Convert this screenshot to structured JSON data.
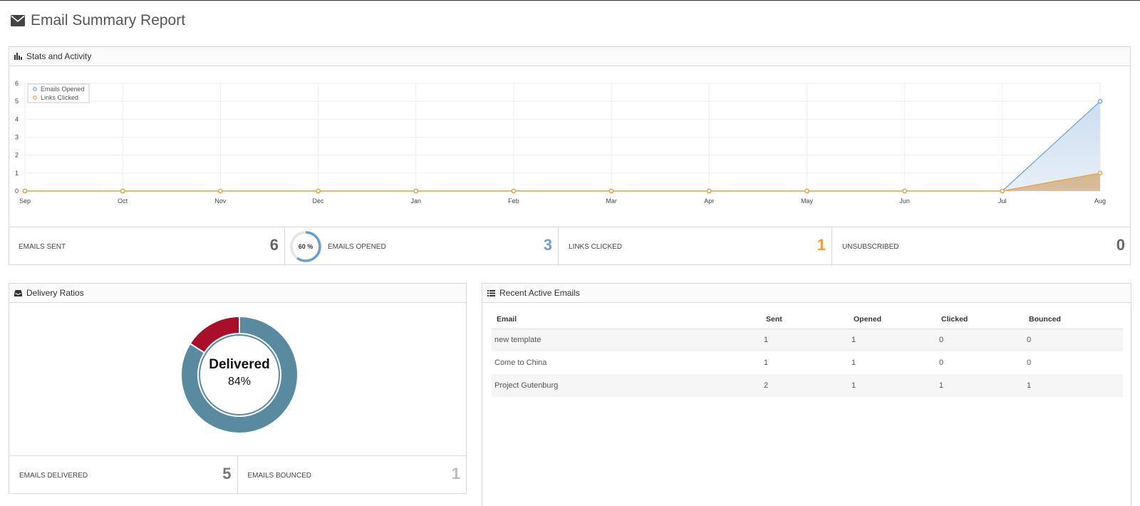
{
  "page": {
    "title": "Email Summary Report",
    "icon": "envelope-icon"
  },
  "stats_panel": {
    "title": "Stats and Activity",
    "icon": "bar-chart-icon",
    "stats": {
      "emails_sent": {
        "label": "EMAILS SENT",
        "value": "6",
        "color": "#666666"
      },
      "emails_opened": {
        "label": "EMAILS OPENED",
        "value": "3",
        "color": "#6a9fcb",
        "gauge_text": "60 %",
        "gauge_fraction": 0.6
      },
      "links_clicked": {
        "label": "LINKS CLICKED",
        "value": "1",
        "color": "#f39c33"
      },
      "unsubscribed": {
        "label": "UNSUBSCRIBED",
        "value": "0",
        "color": "#666666"
      }
    }
  },
  "chart_data": {
    "type": "area",
    "categories": [
      "Sep",
      "Oct",
      "Nov",
      "Dec",
      "Jan",
      "Feb",
      "Mar",
      "Apr",
      "May",
      "Jun",
      "Jul",
      "Aug"
    ],
    "series": [
      {
        "name": "Emails Opened",
        "values": [
          0,
          0,
          0,
          0,
          0,
          0,
          0,
          0,
          0,
          0,
          0,
          5
        ],
        "color": "#6a9fcb"
      },
      {
        "name": "Links Clicked",
        "values": [
          0,
          0,
          0,
          0,
          0,
          0,
          0,
          0,
          0,
          0,
          0,
          1
        ],
        "color": "#f39c33"
      }
    ],
    "ylim": [
      0,
      6
    ],
    "yticks": [
      "0",
      "1",
      "2",
      "3",
      "4",
      "5",
      "6"
    ],
    "grid": true,
    "legend": "top-left"
  },
  "delivery_panel": {
    "title": "Delivery Ratios",
    "icon": "inbox-icon",
    "donut": {
      "title": "Delivered",
      "percent_text": "84%",
      "delivered_fraction": 0.84,
      "delivered_color": "#5a8a9f",
      "bounced_color": "#a8102a"
    },
    "stats": {
      "delivered": {
        "label": "EMAILS DELIVERED",
        "value": "5",
        "color": "#777777"
      },
      "bounced": {
        "label": "EMAILS BOUNCED",
        "value": "1",
        "color": "#bbbbbb"
      }
    }
  },
  "recent_panel": {
    "title": "Recent Active Emails",
    "icon": "list-icon",
    "columns": [
      "Email",
      "Sent",
      "Opened",
      "Clicked",
      "Bounced"
    ],
    "rows": [
      [
        "new template",
        "1",
        "1",
        "0",
        "0"
      ],
      [
        "Come to China",
        "1",
        "1",
        "0",
        "0"
      ],
      [
        "Project Gutenburg",
        "2",
        "1",
        "1",
        "1"
      ]
    ]
  }
}
